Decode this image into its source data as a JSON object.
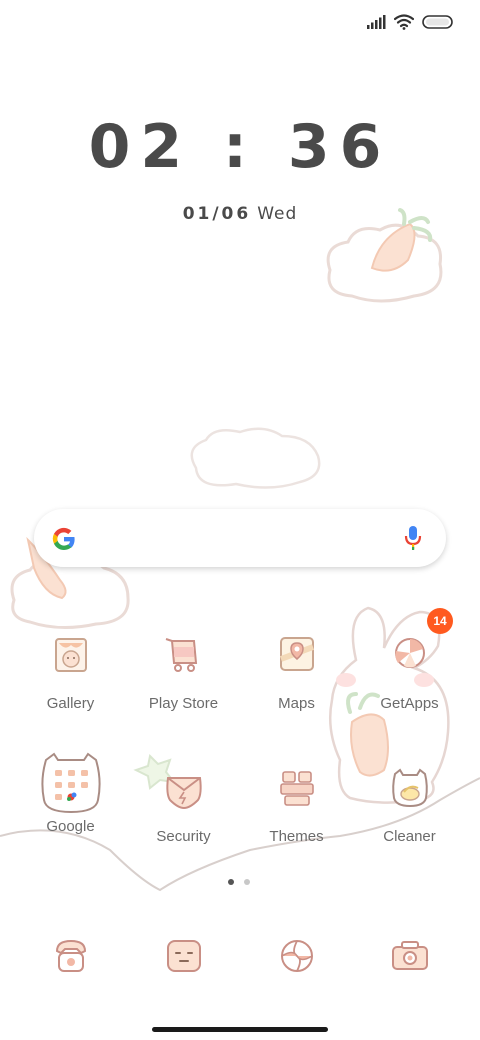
{
  "status_bar": {
    "signal_icon": "signal-bars-icon",
    "wifi_icon": "wifi-icon",
    "battery_icon": "battery-icon"
  },
  "clock": {
    "time": "02 : 36",
    "date_numeric": "01/06",
    "weekday": "Wed"
  },
  "search": {
    "logo_icon": "google-g-icon",
    "mic_icon": "microphone-icon"
  },
  "apps": [
    {
      "label": "Gallery",
      "icon": "gallery-icon"
    },
    {
      "label": "Play Store",
      "icon": "play-store-icon"
    },
    {
      "label": "Maps",
      "icon": "maps-icon"
    },
    {
      "label": "GetApps",
      "icon": "getapps-icon",
      "badge": "14"
    },
    {
      "label": "Google",
      "icon": "google-folder-icon"
    },
    {
      "label": "Security",
      "icon": "security-icon"
    },
    {
      "label": "Themes",
      "icon": "themes-icon"
    },
    {
      "label": "Cleaner",
      "icon": "cleaner-icon"
    }
  ],
  "page_indicator": {
    "pages": 2,
    "active": 1
  },
  "dock": [
    {
      "icon": "phone-icon"
    },
    {
      "icon": "messages-icon"
    },
    {
      "icon": "browser-icon"
    },
    {
      "icon": "camera-icon"
    }
  ],
  "colors": {
    "accent_pink": "#f4c9b5",
    "carrot": "#f6c3a4",
    "badge": "#ff5a1f",
    "text": "#6b6b6b"
  }
}
